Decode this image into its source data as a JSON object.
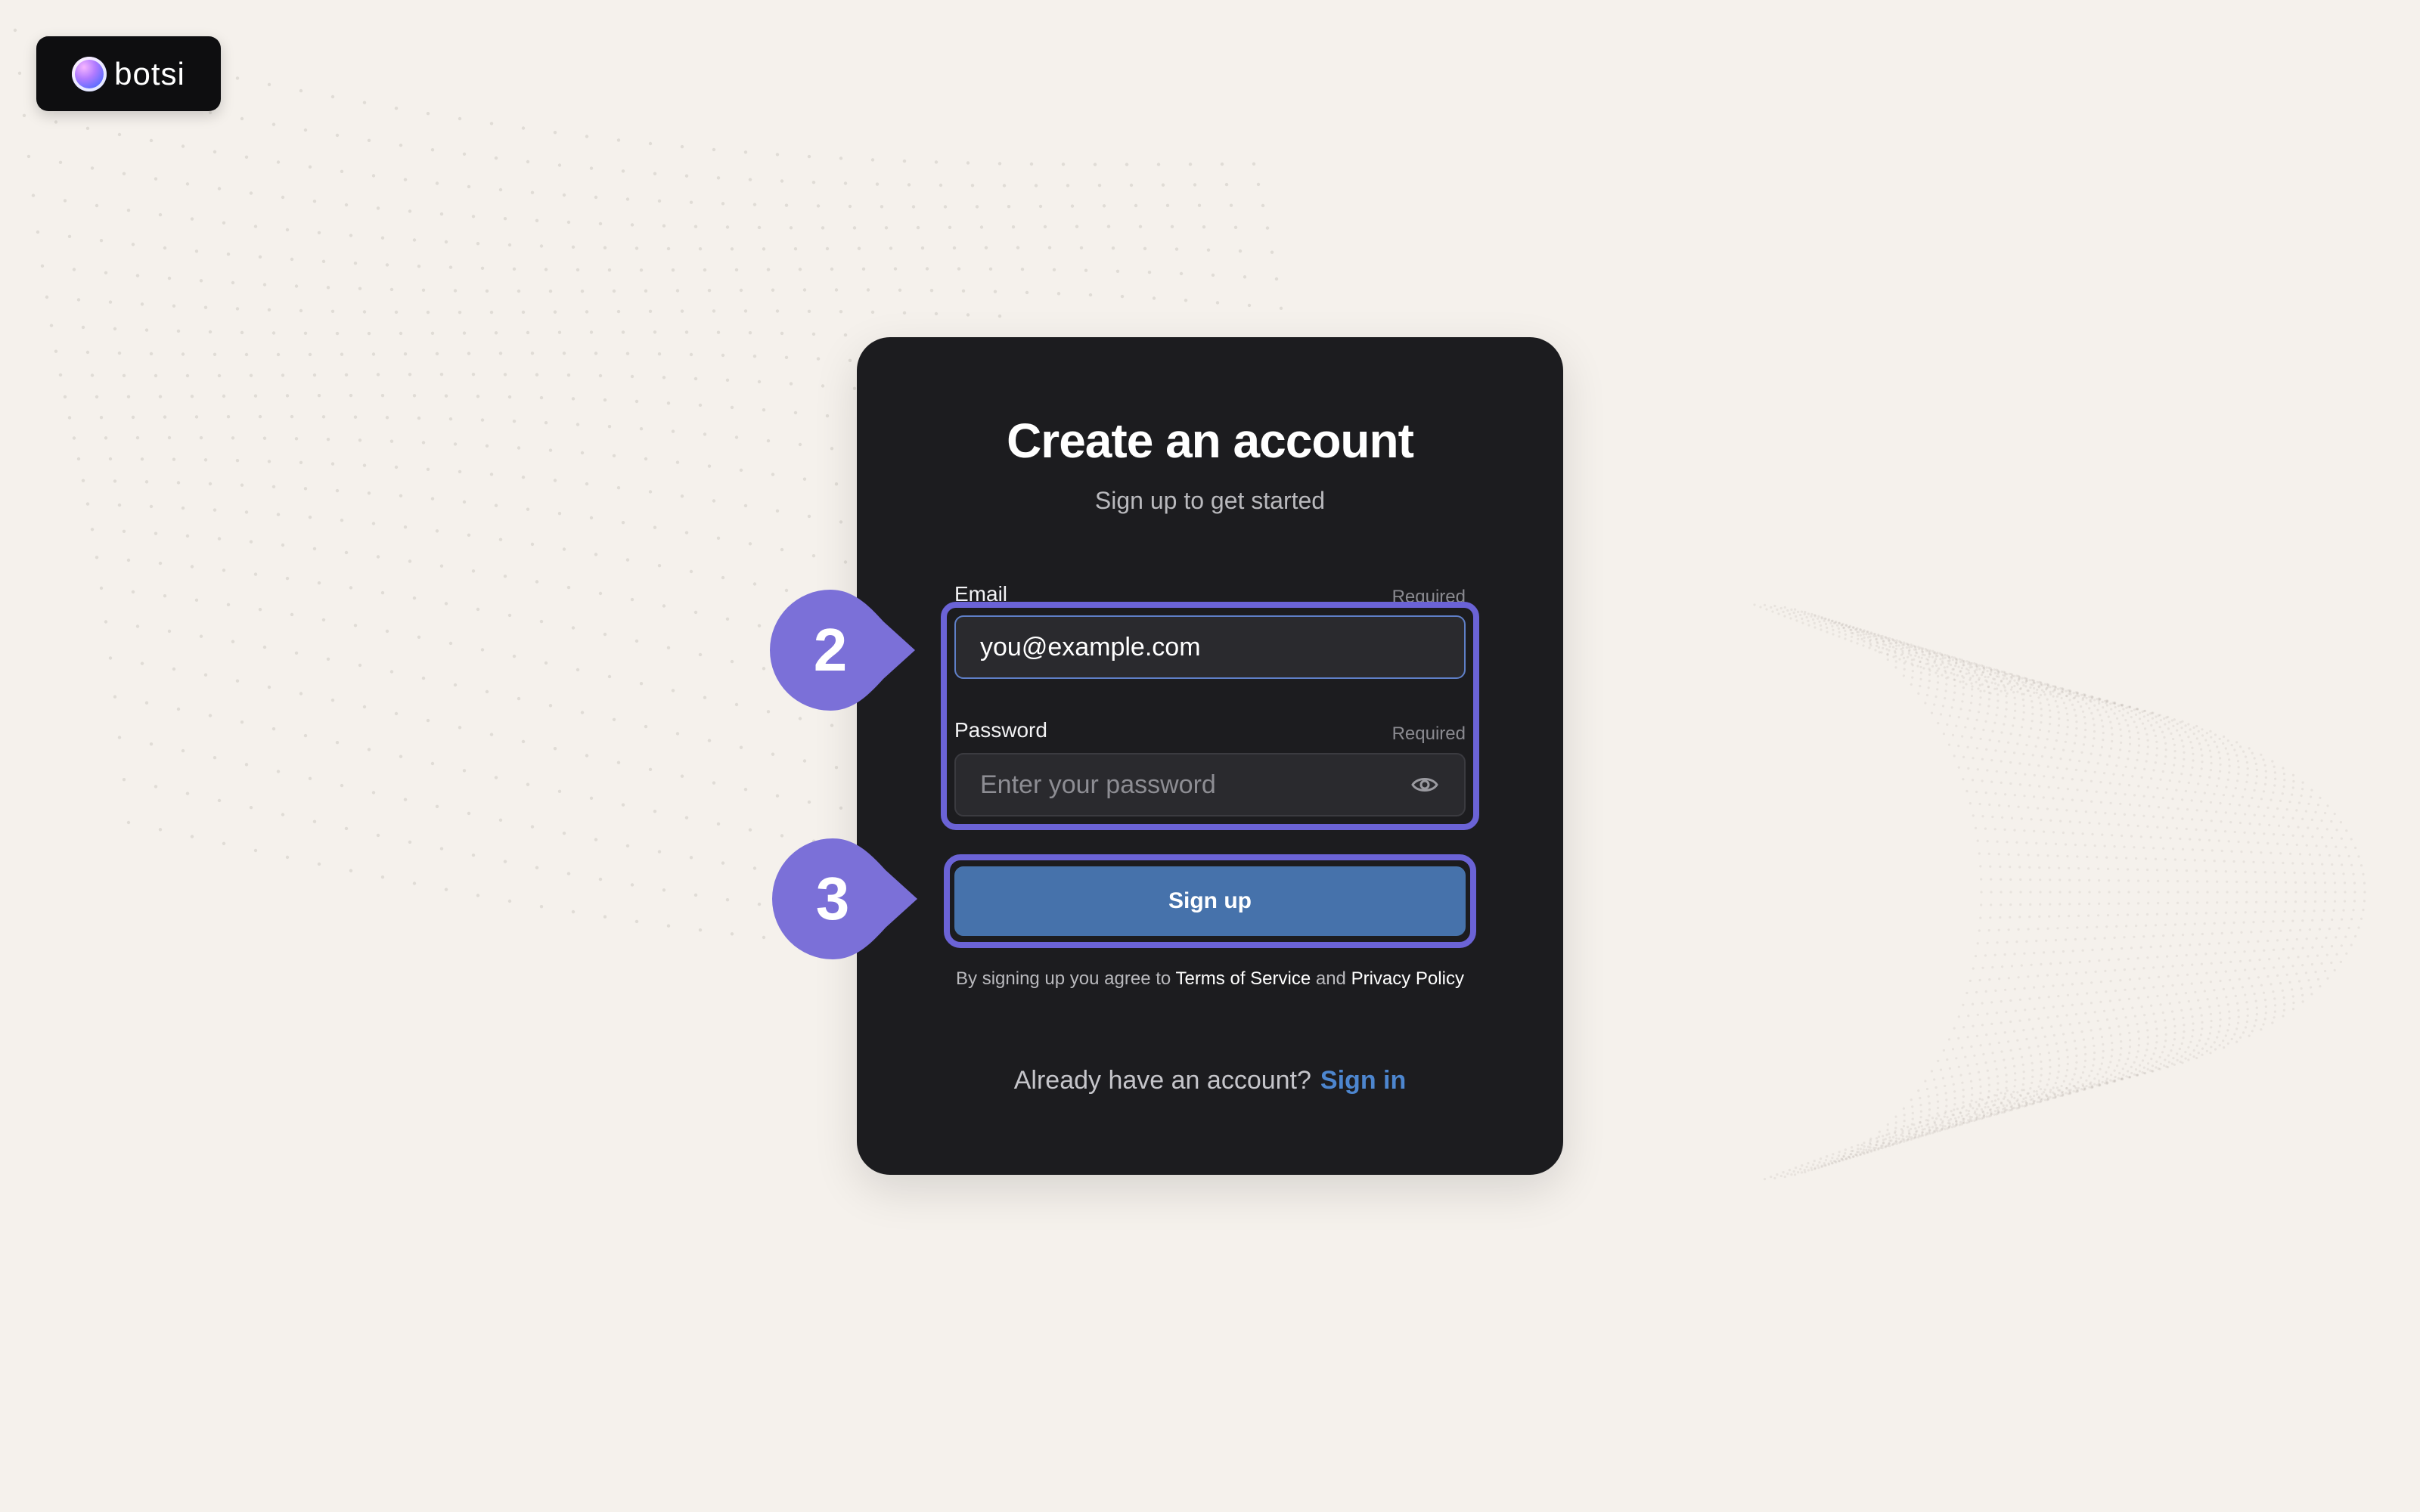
{
  "logo": {
    "text": "botsi"
  },
  "card": {
    "title": "Create an account",
    "subtitle": "Sign up to get started"
  },
  "email": {
    "label": "Email",
    "required": "Required",
    "value": "you@example.com",
    "placeholder": ""
  },
  "password": {
    "label": "Password",
    "required": "Required",
    "value": "",
    "placeholder": "Enter your password",
    "toggle_icon": "eye-icon"
  },
  "signup_button": {
    "label": "Sign up"
  },
  "legal": {
    "prefix": "By signing up you agree to ",
    "terms": "Terms of Service",
    "and": " and ",
    "privacy": "Privacy Policy"
  },
  "signin": {
    "prompt": "Already have an account?",
    "link": "Sign in"
  },
  "markers": [
    {
      "number": "2"
    },
    {
      "number": "3"
    }
  ],
  "colors": {
    "background": "#f5f1ec",
    "card": "#1c1c1f",
    "accent_button": "#4672ab",
    "marker": "#7b70d8",
    "highlight": "#6b63d6",
    "link": "#4d86cf"
  }
}
